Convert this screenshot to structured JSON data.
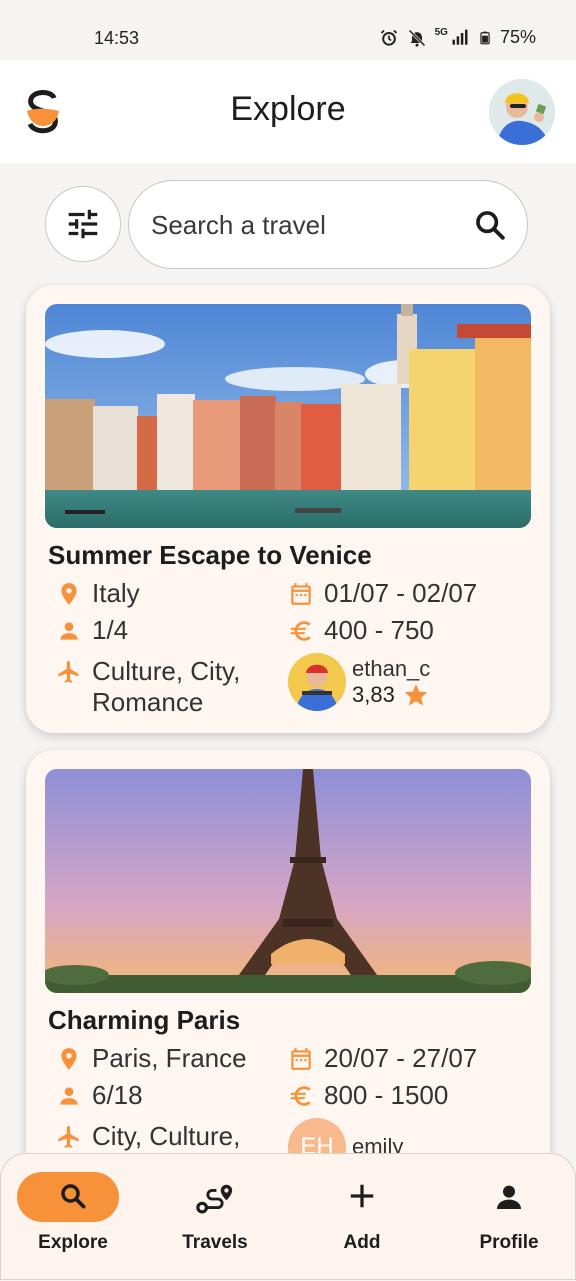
{
  "status_bar": {
    "time": "14:53",
    "network": "5G",
    "battery": "75%"
  },
  "header": {
    "title": "Explore"
  },
  "search": {
    "placeholder": "Search a travel"
  },
  "colors": {
    "accent": "#F7913A",
    "card_bg": "#FDF6F1"
  },
  "travels": [
    {
      "title": "Summer Escape to Venice",
      "location": "Italy",
      "dates": "01/07 - 02/07",
      "participants": "1/4",
      "budget": "400 - 750",
      "tags_line1": "Culture, City,",
      "tags_line2": "Romance",
      "organizer": "ethan_c",
      "rating": "3,83"
    },
    {
      "title": "Charming Paris",
      "location": "Paris, France",
      "dates": "20/07 - 27/07",
      "participants": "6/18",
      "budget": "800 - 1500",
      "tags_line1": "City, Culture,",
      "organizer": "emily",
      "organizer_initials": "EH"
    }
  ],
  "bottom_nav": [
    {
      "label": "Explore",
      "icon": "search-icon",
      "active": true
    },
    {
      "label": "Travels",
      "icon": "route-icon",
      "active": false
    },
    {
      "label": "Add",
      "icon": "plus-icon",
      "active": false
    },
    {
      "label": "Profile",
      "icon": "person-icon",
      "active": false
    }
  ]
}
